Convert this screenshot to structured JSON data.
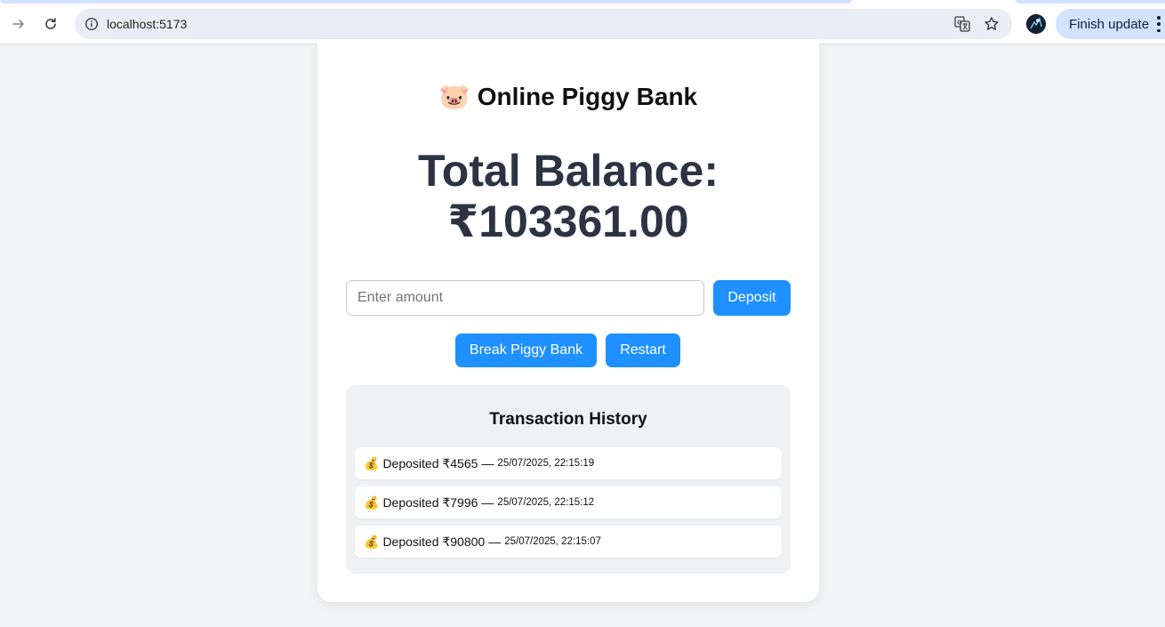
{
  "browser": {
    "url": "localhost:5173",
    "finish_update_label": "Finish update"
  },
  "app": {
    "title_emoji": "🐷",
    "title": "Online Piggy Bank",
    "balance_line1": "Total Balance:",
    "balance_line2": "₹103361.00",
    "amount_placeholder": "Enter amount",
    "amount_value": "",
    "deposit_label": "Deposit",
    "break_label": "Break Piggy Bank",
    "restart_label": "Restart"
  },
  "history": {
    "title": "Transaction History",
    "items": [
      {
        "icon": "💰",
        "text": "Deposited ₹4565",
        "separator": "—",
        "time": "25/07/2025, 22:15:19"
      },
      {
        "icon": "💰",
        "text": "Deposited ₹7996",
        "separator": "—",
        "time": "25/07/2025, 22:15:12"
      },
      {
        "icon": "💰",
        "text": "Deposited ₹90800",
        "separator": "—",
        "time": "25/07/2025, 22:15:07"
      }
    ]
  }
}
